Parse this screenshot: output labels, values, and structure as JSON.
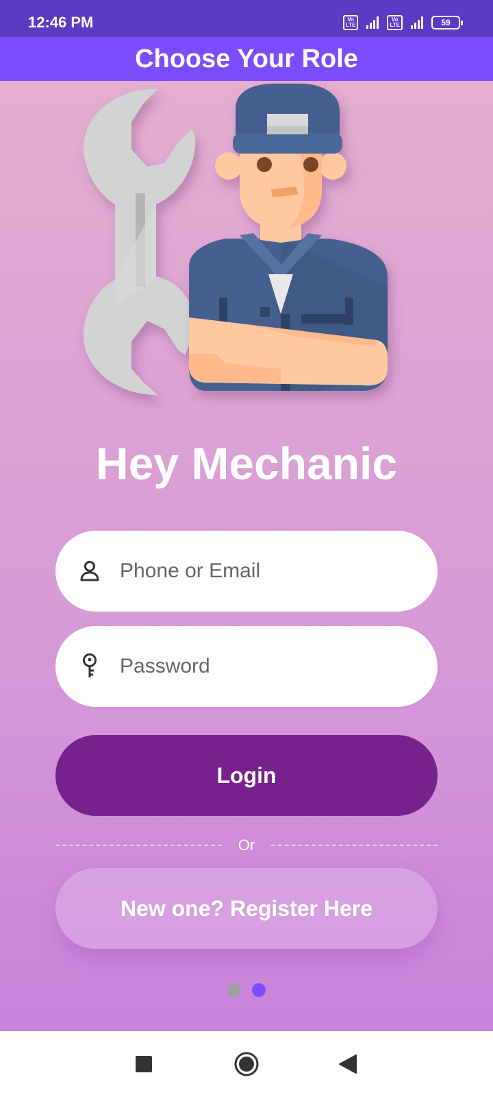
{
  "status_bar": {
    "time": "12:46 PM",
    "sim1": "Vo LTE",
    "sim2": "Vo LTE",
    "battery": "59",
    "icons": [
      "volte-icon",
      "signal-icon",
      "volte-icon",
      "signal-icon",
      "battery-icon"
    ]
  },
  "app_bar": {
    "title": "Choose Your Role"
  },
  "hero": {
    "icons": [
      "wrench-icon",
      "mechanic-illustration"
    ]
  },
  "greeting": "Hey Mechanic",
  "form": {
    "identifier": {
      "placeholder": "Phone or Email",
      "value": "",
      "icon": "person-icon"
    },
    "password": {
      "placeholder": "Password",
      "value": "",
      "icon": "key-icon"
    },
    "login_label": "Login",
    "divider_label": "Or",
    "register_label": "New one? Register Here"
  },
  "pager": {
    "total": 2,
    "current": 2
  },
  "nav_bar": {
    "icons": [
      "recents-icon",
      "home-icon",
      "back-icon"
    ]
  },
  "colors": {
    "status_bar": "#5b3bc4",
    "app_bar": "#7c4dff",
    "login_button": "#77228c",
    "active_dot": "#7c4dff",
    "inactive_dot": "#9e9e9e"
  }
}
